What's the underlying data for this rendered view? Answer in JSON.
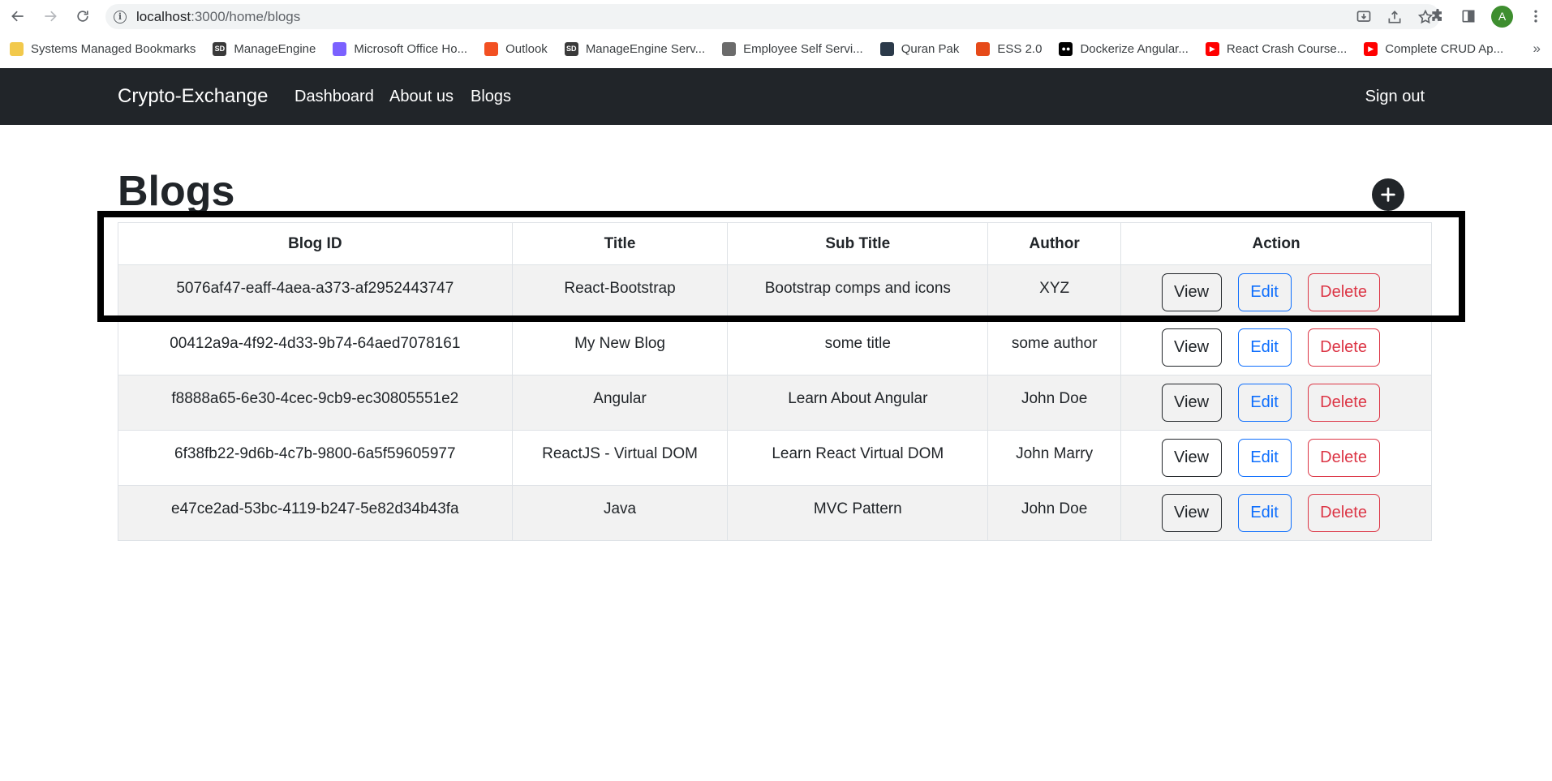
{
  "browser": {
    "url_host": "localhost",
    "url_rest": ":3000/home/blogs",
    "profile_initial": "A",
    "bookmarks": [
      {
        "label": "Systems Managed Bookmarks",
        "icon": "folder-icon",
        "color": "#f2c94c",
        "glyph": ""
      },
      {
        "label": "ManageEngine",
        "icon": "sd-icon",
        "color": "#3a3a3a",
        "glyph": "SD"
      },
      {
        "label": "Microsoft Office Ho...",
        "icon": "office-icon",
        "color": "#7b61ff",
        "glyph": ""
      },
      {
        "label": "Outlook",
        "icon": "windows-icon",
        "color": "#f25022",
        "glyph": ""
      },
      {
        "label": "ManageEngine Serv...",
        "icon": "sd-icon",
        "color": "#3a3a3a",
        "glyph": "SD"
      },
      {
        "label": "Employee Self Servi...",
        "icon": "globe-icon",
        "color": "#6b6b6b",
        "glyph": ""
      },
      {
        "label": "Quran Pak",
        "icon": "quran-icon",
        "color": "#2b3a4a",
        "glyph": ""
      },
      {
        "label": "ESS 2.0",
        "icon": "ess-icon",
        "color": "#e64a19",
        "glyph": ""
      },
      {
        "label": "Dockerize Angular...",
        "icon": "medium-icon",
        "color": "#000000",
        "glyph": "●●"
      },
      {
        "label": "React Crash Course...",
        "icon": "youtube-icon",
        "color": "#ff0000",
        "glyph": "▶"
      },
      {
        "label": "Complete CRUD Ap...",
        "icon": "youtube-icon",
        "color": "#ff0000",
        "glyph": "▶"
      }
    ],
    "more_bookmarks": "»"
  },
  "navbar": {
    "brand": "Crypto-Exchange",
    "links": [
      "Dashboard",
      "About us",
      "Blogs"
    ],
    "signout": "Sign out"
  },
  "page": {
    "title": "Blogs"
  },
  "table": {
    "headers": [
      "Blog ID",
      "Title",
      "Sub Title",
      "Author",
      "Action"
    ],
    "rows": [
      {
        "id": "5076af47-eaff-4aea-a373-af2952443747",
        "title": "React-Bootstrap",
        "subtitle": "Bootstrap comps and icons",
        "author": "XYZ"
      },
      {
        "id": "00412a9a-4f92-4d33-9b74-64aed7078161",
        "title": "My New Blog",
        "subtitle": "some title",
        "author": "some author"
      },
      {
        "id": "f8888a65-6e30-4cec-9cb9-ec30805551e2",
        "title": "Angular",
        "subtitle": "Learn About Angular",
        "author": "John Doe"
      },
      {
        "id": "6f38fb22-9d6b-4c7b-9800-6a5f59605977",
        "title": "ReactJS - Virtual DOM",
        "subtitle": "Learn React Virtual DOM",
        "author": "John Marry"
      },
      {
        "id": "e47ce2ad-53bc-4119-b247-5e82d34b43fa",
        "title": "Java",
        "subtitle": "MVC Pattern",
        "author": "John Doe"
      }
    ],
    "actions": {
      "view": "View",
      "edit": "Edit",
      "delete": "Delete"
    }
  },
  "colors": {
    "navbar_bg": "#212529",
    "edit": "#0d6efd",
    "delete": "#dc3545",
    "striped_row": "#f2f2f2",
    "highlight_box": "#000000"
  }
}
